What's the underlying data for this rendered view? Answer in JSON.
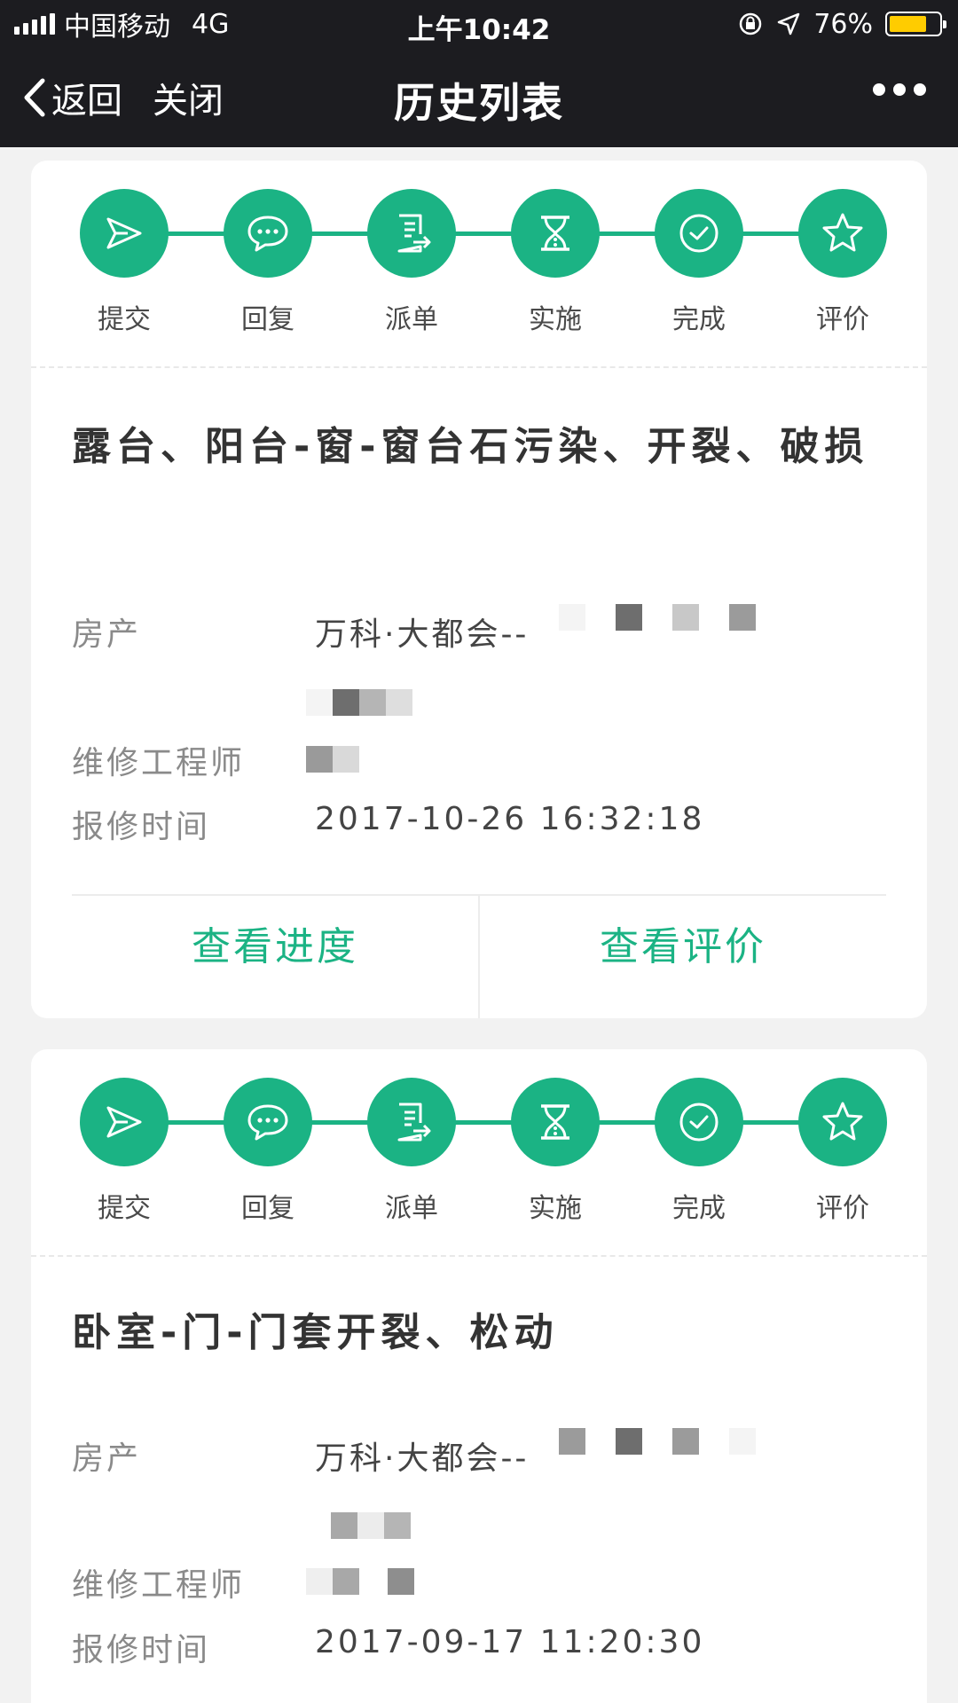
{
  "status_bar": {
    "carrier": "中国移动",
    "network": "4G",
    "time": "上午10:42",
    "battery": "76%",
    "battery_level": 0.76
  },
  "nav": {
    "back_label": "返回",
    "close_label": "关闭",
    "title": "历史列表"
  },
  "colors": {
    "accent": "#1bb384",
    "bar": "#1c1c20",
    "battery": "#ffcc00"
  },
  "steps": [
    {
      "label": "提交",
      "icon": "send-icon"
    },
    {
      "label": "回复",
      "icon": "chat-icon"
    },
    {
      "label": "派单",
      "icon": "dispatch-doc-icon"
    },
    {
      "label": "实施",
      "icon": "hourglass-icon"
    },
    {
      "label": "完成",
      "icon": "check-circle-icon"
    },
    {
      "label": "评价",
      "icon": "star-icon"
    }
  ],
  "field_labels": {
    "property": "房产",
    "engineer": "维修工程师",
    "report_time": "报修时间"
  },
  "records": [
    {
      "title": "露台、阳台-窗-窗台石污染、开裂、破损",
      "property": "万科·大都会--",
      "report_time": "2017-10-26 16:32:18",
      "btn_progress": "查看进度",
      "btn_review": "查看评价"
    },
    {
      "title": "卧室-门-门套开裂、松动",
      "property": "万科·大都会--",
      "report_time": "2017-09-17 11:20:30"
    }
  ]
}
